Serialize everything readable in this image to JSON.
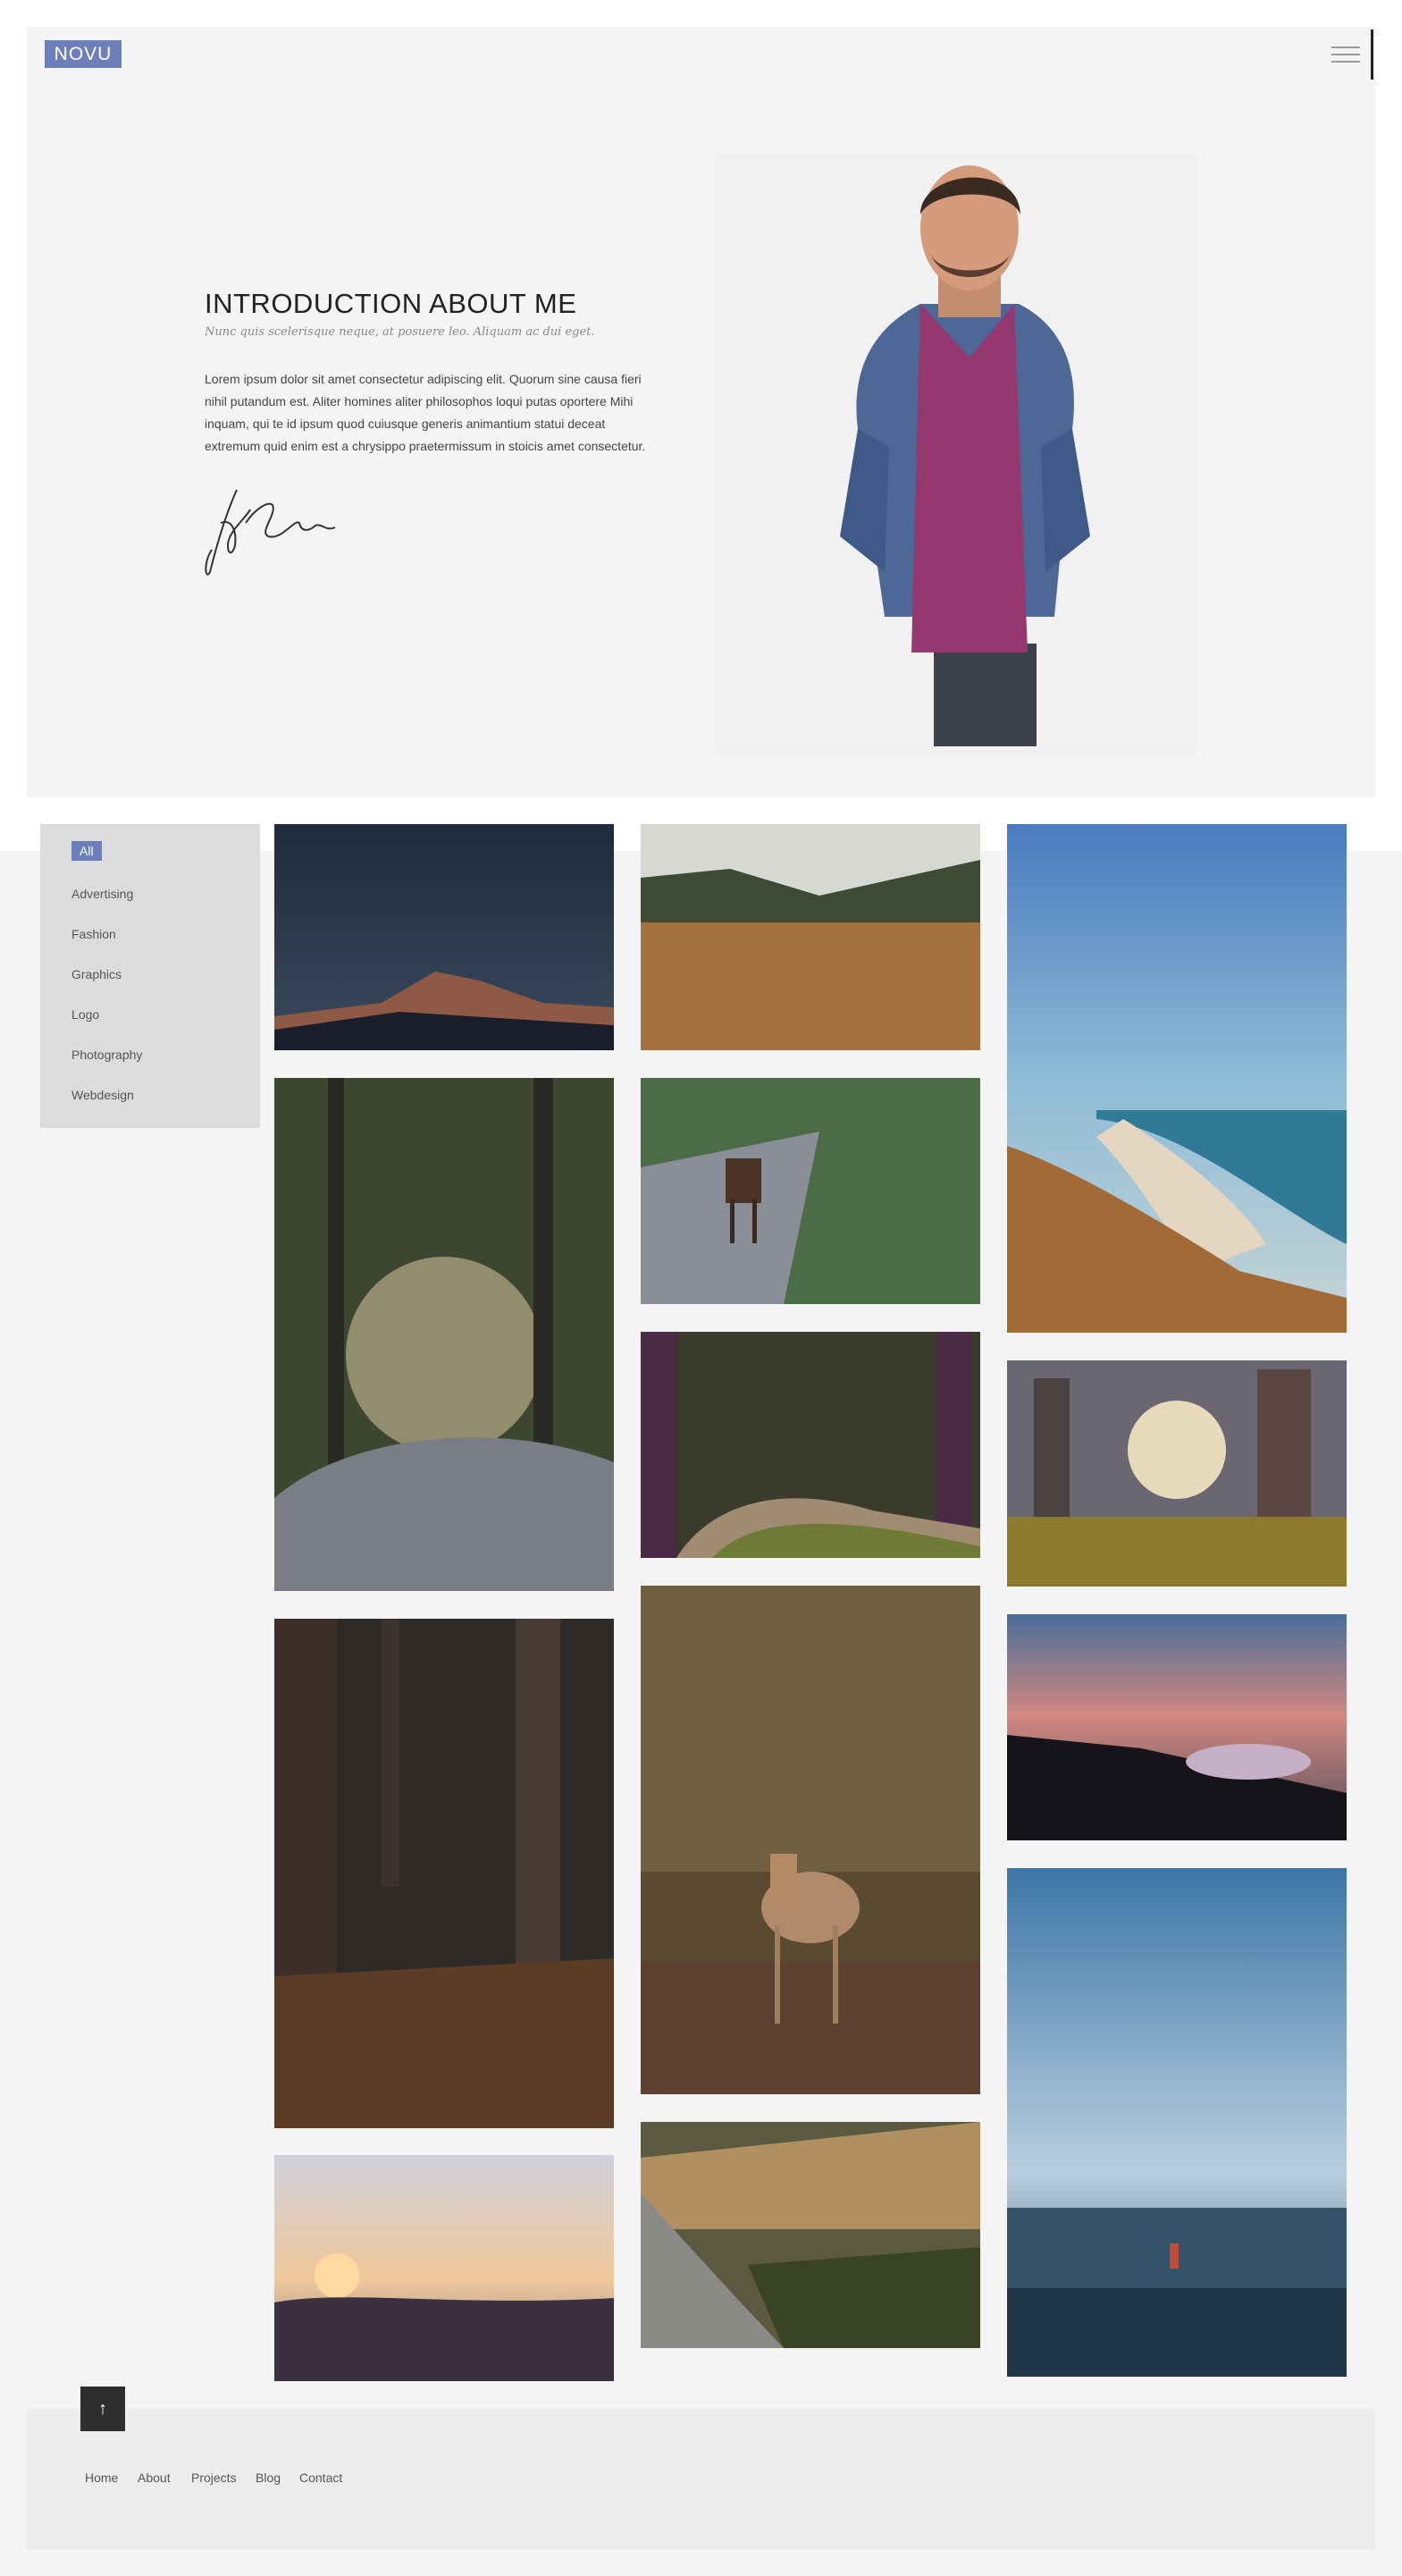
{
  "brand": {
    "logo_text": "NOVU",
    "accent": "#6d7fba"
  },
  "intro": {
    "title": "INTRODUCTION ABOUT ME",
    "subtitle": "Nunc quis scelerisque neque, at posuere leo. Aliquam ac dui eget.",
    "body_lines": [
      "Lorem ipsum dolor sit amet consectetur adipiscing elit. Quorum sine causa fieri",
      "nihil putandum est. Aliter homines aliter philosophos loqui putas oportere Mihi",
      "inquam, qui te id ipsum quod cuiusque generis animantium statui deceat",
      "extremum quid enim est a chrysippo praetermissum in stoicis amet consectetur."
    ],
    "signature_icon": "signature"
  },
  "filters": [
    "All",
    "Advertising",
    "Fashion",
    "Graphics",
    "Logo",
    "Photography",
    "Webdesign"
  ],
  "gallery_icons": [
    "night-mountain",
    "golden-field",
    "coastal-cliff",
    "forest-rock",
    "deer-stream",
    "forest-path",
    "sun-meadow",
    "pine-forest",
    "fawn-forest",
    "sunset-clouds",
    "ocean-paddler",
    "rocky-sunset",
    "valley-cliff"
  ],
  "footer": {
    "links": [
      "Home",
      "About",
      "Projects",
      "Blog",
      "Contact"
    ],
    "top_icon": "arrow-up-icon",
    "top_glyph": "↑"
  }
}
